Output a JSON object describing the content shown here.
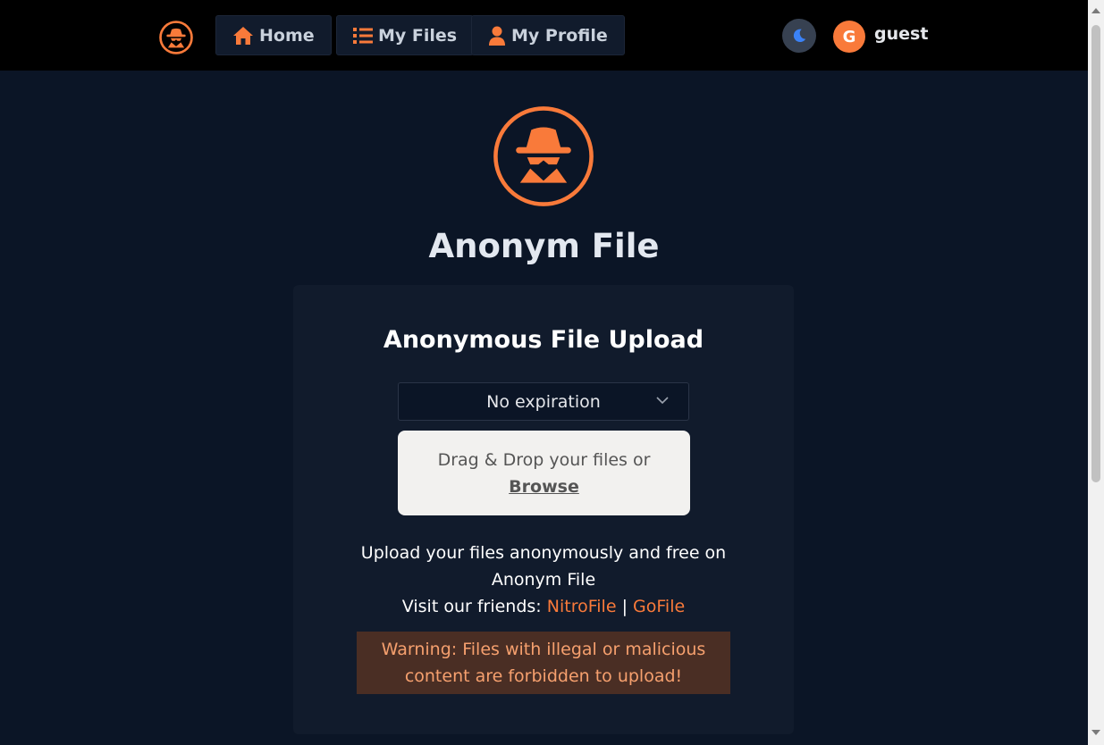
{
  "nav": {
    "logo_icon": "spy-icon",
    "items": [
      {
        "label": "Home",
        "icon": "home-icon"
      },
      {
        "label": "My Files",
        "icon": "list-icon"
      },
      {
        "label": "My Profile",
        "icon": "user-icon"
      }
    ],
    "theme_icon": "moon-icon",
    "avatar_initial": "G",
    "username": "guest"
  },
  "hero": {
    "logo_icon": "spy-icon",
    "title": "Anonym File"
  },
  "upload": {
    "title": "Anonymous File Upload",
    "expiration": "No expiration",
    "dropzone_text": "Drag & Drop your files or",
    "browse_label": "Browse",
    "info_line1": "Upload your files anonymously and free on Anonym File",
    "info_line2_prefix": "Visit our friends:",
    "friends": [
      "NitroFile",
      "GoFile"
    ],
    "separator": "|",
    "warning": "Warning: Files with illegal or malicious content are forbidden to upload!"
  },
  "colors": {
    "accent": "#f97a3a",
    "background": "#0b1526",
    "card": "#111b2c",
    "warning_bg": "#4a2e24"
  }
}
